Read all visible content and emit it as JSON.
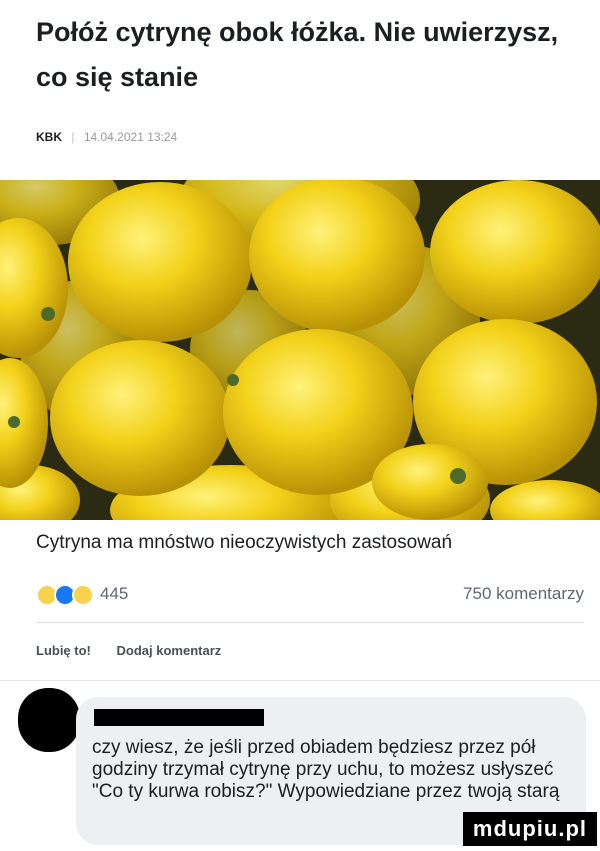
{
  "article": {
    "title": "Połóż cytrynę obok łóżka. Nie uwierzysz, co się stanie",
    "author": "KBK",
    "separator": "|",
    "datetime": "14.04.2021 13:24",
    "caption": "Cytryna ma mnóstwo nieoczywistych zastosowań"
  },
  "stats": {
    "reactions": [
      "haha-icon",
      "like-icon",
      "wow-icon"
    ],
    "reaction_count": "445",
    "comments_count": "750 komentarzy"
  },
  "actions": {
    "like_label": "Lubię to!",
    "comment_label": "Dodaj komentarz"
  },
  "comment": {
    "text": "czy wiesz, że jeśli przed obiadem będziesz przez pół godziny trzymał cytrynę przy uchu, to możesz usłyszeć \"Co ty kurwa robisz?\" Wypowiedziane przez twoją starą"
  },
  "watermark": "mdupiu.pl",
  "colors": {
    "lemon": "#f3d21a",
    "lemon_shadow": "#c9a508",
    "background_dark": "#2b2a12",
    "like_blue": "#1877f2",
    "comment_bg": "#eeeff1"
  }
}
